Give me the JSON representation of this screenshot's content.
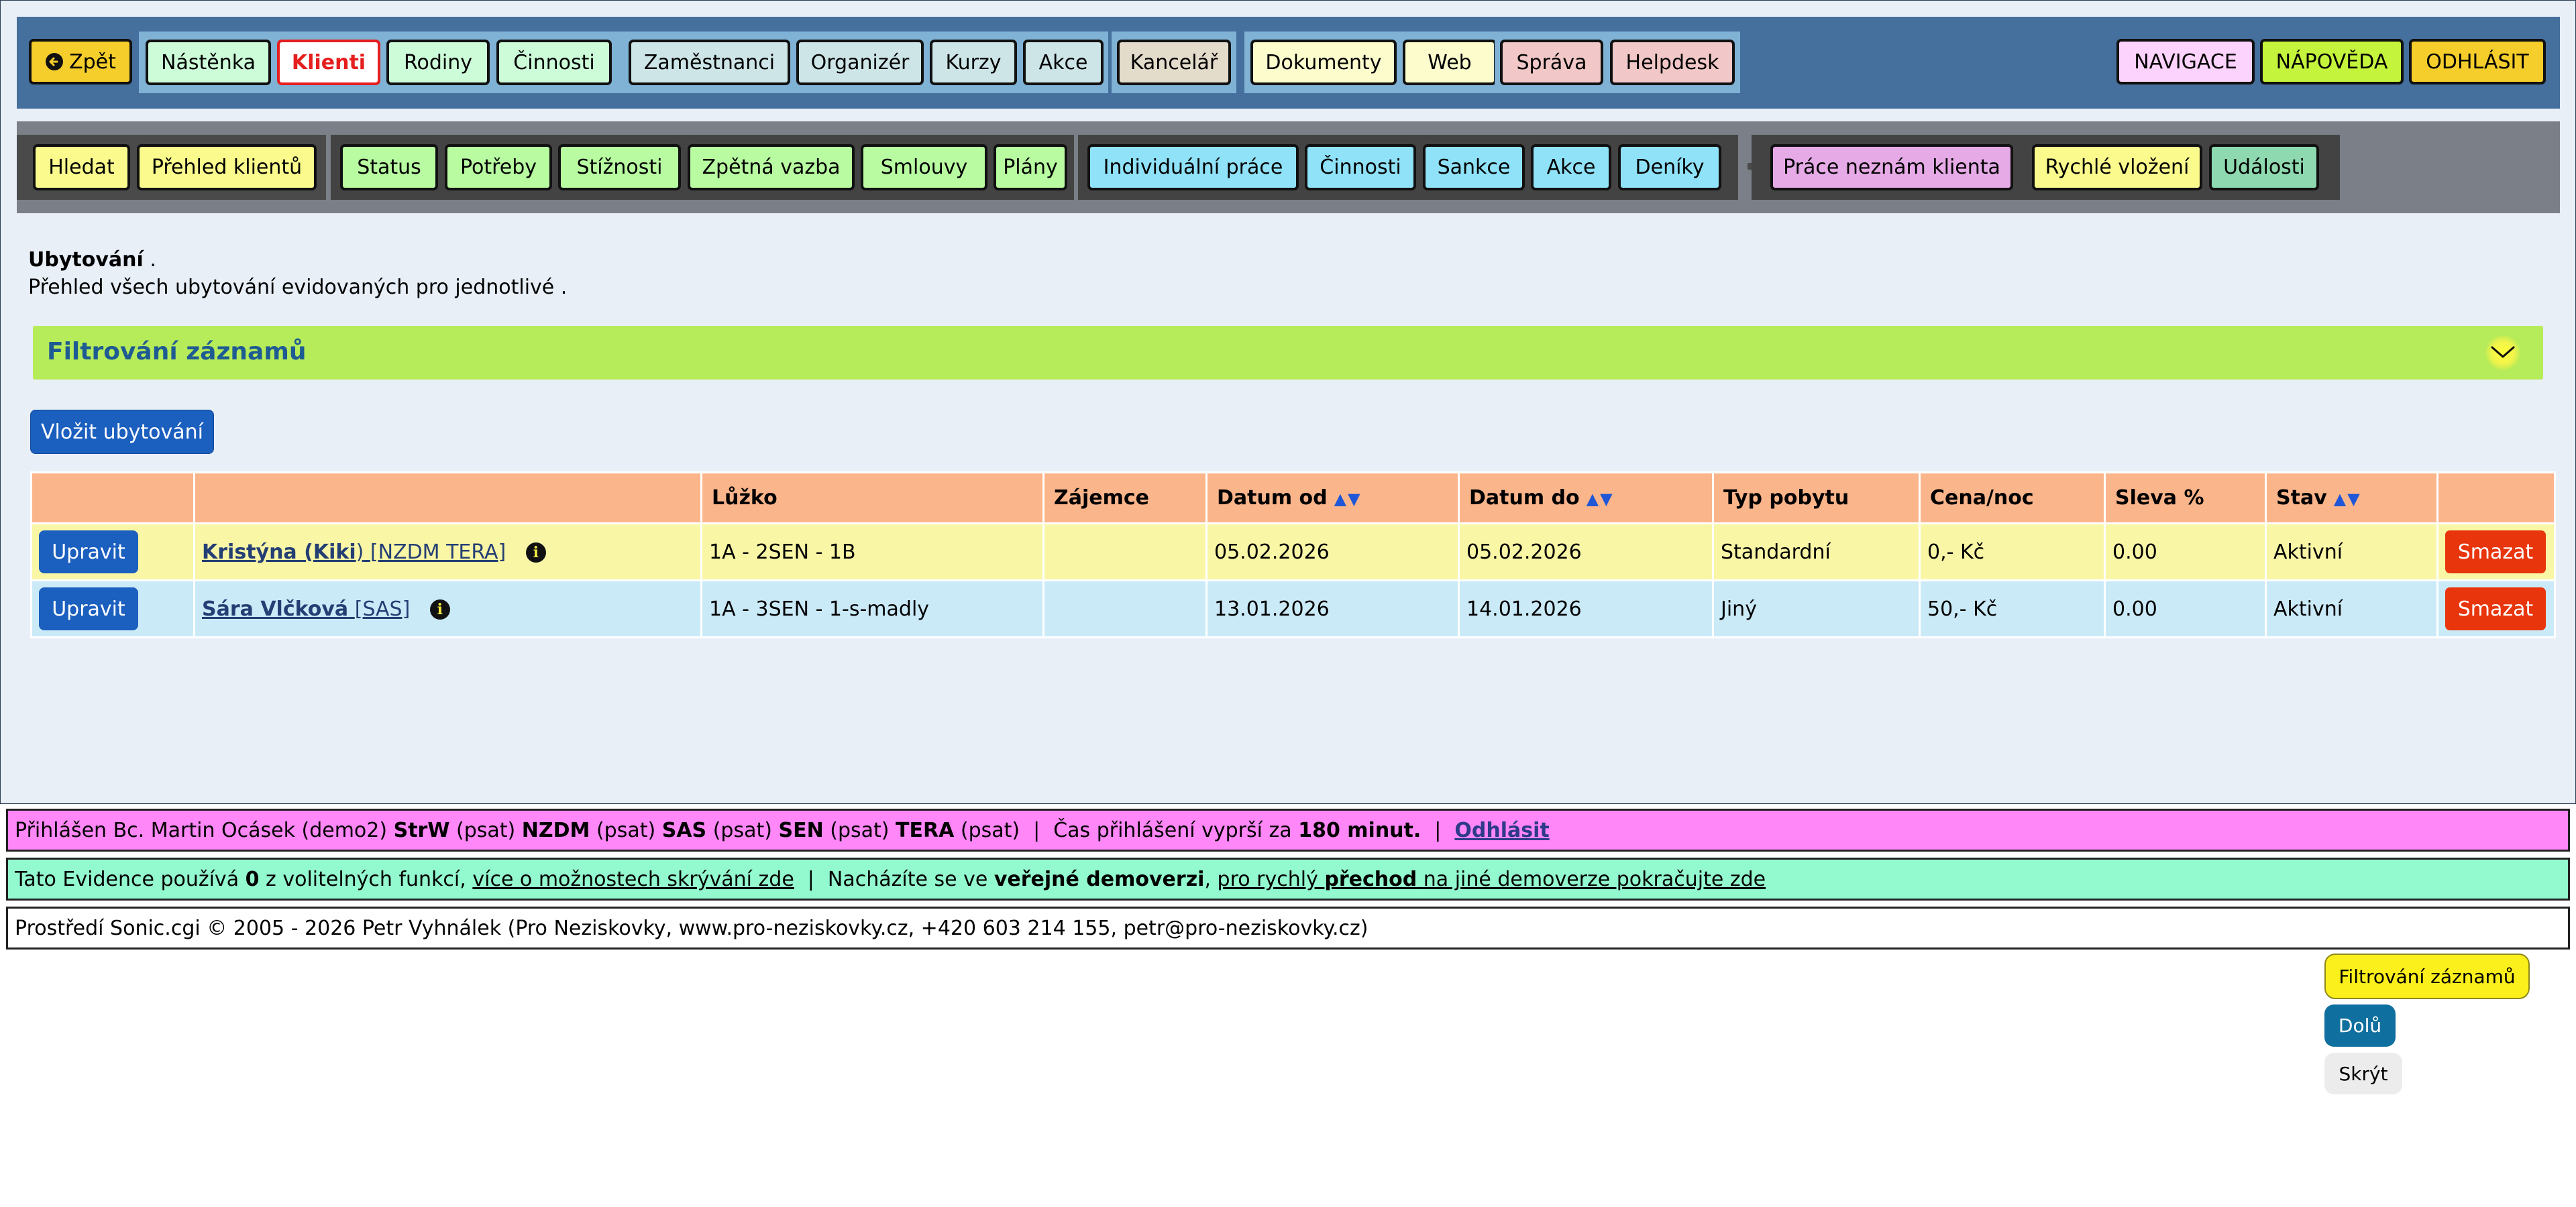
{
  "topnav": {
    "back": "Zpět",
    "items": [
      "Nástěnka",
      "Klienti",
      "Rodiny",
      "Činnosti",
      "Zaměstnanci",
      "Organizér",
      "Kurzy",
      "Akce",
      "Kancelář",
      "Dokumenty",
      "Web",
      "Správa",
      "Helpdesk"
    ],
    "right": [
      "NAVIGACE",
      "NÁPOVĚDA",
      "ODHLÁSIT"
    ]
  },
  "secnav": {
    "items": [
      "Hledat",
      "Přehled klientů",
      "Status",
      "Potřeby",
      "Stížnosti",
      "Zpětná vazba",
      "Smlouvy",
      "Plány",
      "Individuální práce",
      "Činnosti",
      "Sankce",
      "Akce",
      "Deníky",
      "Práce neznám klienta",
      "Rychlé vložení",
      "Události"
    ]
  },
  "intro": {
    "title": "Ubytování",
    "title_suffix": " .",
    "subtitle": "Přehled všech ubytování evidovaných pro jednotlivé ."
  },
  "filter": {
    "title": "Filtrování záznamů"
  },
  "insert_label": "Vložit ubytování",
  "table": {
    "headers": [
      "",
      "",
      "Lůžko",
      "Zájemce",
      "Datum od",
      "Datum do",
      "Typ pobytu",
      "Cena/noc",
      "Sleva %",
      "Stav",
      ""
    ],
    "sort_arrows": "▲▼",
    "edit_label": "Upravit",
    "delete_label": "Smazat",
    "rows": [
      {
        "name_first": "Kristýna (",
        "name_bold": "Kiki",
        "name_rest": ")",
        "groups": "[NZDM TERA]",
        "bed": "1A - 2SEN - 1B",
        "applicant": "",
        "date_from": "05.02.2026",
        "date_to": "05.02.2026",
        "stay_type": "Standardní",
        "price": "0,- Kč",
        "discount": "0.00",
        "status": "Aktivní"
      },
      {
        "name_first": "Sára Vlčková",
        "name_bold": "",
        "name_rest": "",
        "groups": "[SAS]",
        "bed": "1A - 3SEN - 1-s-madly",
        "applicant": "",
        "date_from": "13.01.2026",
        "date_to": "14.01.2026",
        "stay_type": "Jiný",
        "price": "50,- Kč",
        "discount": "0.00",
        "status": "Aktivní"
      }
    ]
  },
  "login_bar": {
    "prefix": "Přihlášen Bc. Martin Ocásek (demo2)",
    "roles": [
      {
        "code": "StrW",
        "perm": "(psat)"
      },
      {
        "code": "NZDM",
        "perm": "(psat)"
      },
      {
        "code": "SAS",
        "perm": "(psat)"
      },
      {
        "code": "SEN",
        "perm": "(psat)"
      },
      {
        "code": "TERA",
        "perm": "(psat)"
      }
    ],
    "separator": "|",
    "expire_text": "Čas přihlášení vyprší za",
    "expire_value": "180 minut.",
    "logout": "Odhlásit"
  },
  "features_bar": {
    "t1": "Tato Evidence používá",
    "count": "0",
    "t2": "z volitelných funkcí,",
    "link1": "více o možnostech skrývání zde",
    "separator": "|",
    "t3": "Nacházíte se ve",
    "bold1": "veřejné demoverzi",
    "comma": ",",
    "link2a": "pro rychlý",
    "link2b": "přechod",
    "link2c": "na jiné demoverze pokračujte zde"
  },
  "footer": {
    "t1": "Prostředí",
    "link1": "Sonic.cgi",
    "t2": "© 2005 - 2026 Petr Vyhnálek (Pro Neziskovky,",
    "link2": "www.pro-neziskovky.cz",
    "t3": ", +420 603 214 155,",
    "link3": "petr@pro-neziskovky.cz",
    "t4": ")"
  },
  "floating": {
    "filter": "Filtrování záznamů",
    "down": "Dolů",
    "hide": "Skrýt"
  },
  "colors": {
    "topnav_bg": "#456f9c",
    "secnav_bg": "#7b8088",
    "filter_bar": "#b6eb59",
    "table_header": "#fbb58b",
    "row_yellow": "#f9f6a6",
    "row_blue": "#cbeaf8",
    "primary_button": "#1b5fbf",
    "delete_button": "#e8350c",
    "login_bar": "#ff87f7",
    "features_bar": "#93f9cf"
  },
  "icons": [
    "arrow-left-circle-icon",
    "chevron-down-icon",
    "info-icon",
    "sort-arrows-icon"
  ]
}
